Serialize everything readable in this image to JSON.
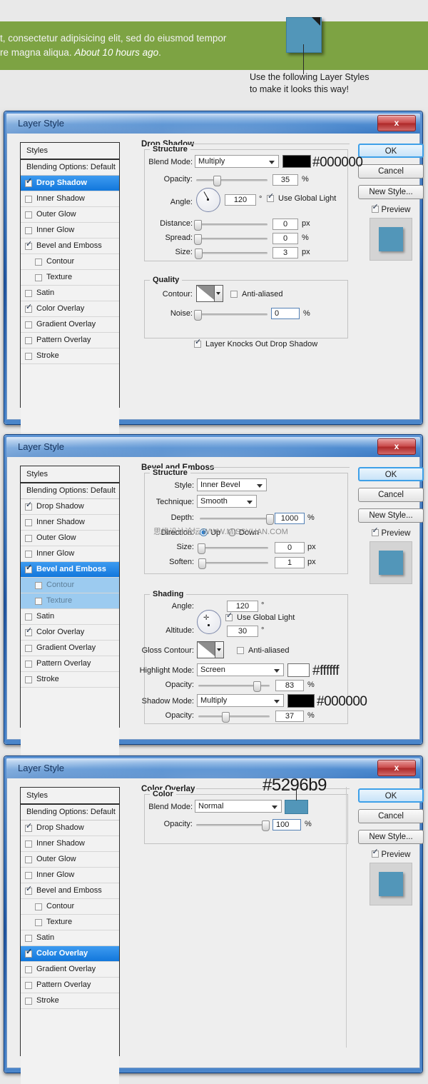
{
  "banner": {
    "text_line1": "t, consectetur adipisicing elit, sed do eiusmod tempor",
    "text_line2a": "re magna aliqua.  ",
    "text_line2b": "About 10 hours ago",
    "text_line2c": ".",
    "caption_line1": "Use the following Layer Styles",
    "caption_line2": "to make it looks this way!",
    "green_color": "#7da343",
    "square_color": "#5296b9"
  },
  "common": {
    "window_title": "Layer Style",
    "close_label": "x",
    "styles_header": "Styles",
    "blending_options": "Blending Options: Default",
    "buttons": {
      "ok": "OK",
      "cancel": "Cancel",
      "new_style": "New Style...",
      "preview": "Preview"
    },
    "style_items": [
      {
        "label": "Drop Shadow",
        "checked": true,
        "sub": false
      },
      {
        "label": "Inner Shadow",
        "checked": false,
        "sub": false
      },
      {
        "label": "Outer Glow",
        "checked": false,
        "sub": false
      },
      {
        "label": "Inner Glow",
        "checked": false,
        "sub": false
      },
      {
        "label": "Bevel and Emboss",
        "checked": true,
        "sub": false
      },
      {
        "label": "Contour",
        "checked": false,
        "sub": true
      },
      {
        "label": "Texture",
        "checked": false,
        "sub": true
      },
      {
        "label": "Satin",
        "checked": false,
        "sub": false
      },
      {
        "label": "Color Overlay",
        "checked": true,
        "sub": false
      },
      {
        "label": "Gradient Overlay",
        "checked": false,
        "sub": false
      },
      {
        "label": "Pattern Overlay",
        "checked": false,
        "sub": false
      },
      {
        "label": "Stroke",
        "checked": false,
        "sub": false
      }
    ],
    "watermark": "思缘设计论坛  WWW.MISSYUAN.COM"
  },
  "dialog1": {
    "panel_title": "Drop Shadow",
    "structure_legend": "Structure",
    "quality_legend": "Quality",
    "blend_mode_label": "Blend Mode:",
    "blend_mode_value": "Multiply",
    "blend_color_hex": "#000000",
    "opacity_label": "Opacity:",
    "opacity_value": "35",
    "opacity_unit": "%",
    "angle_label": "Angle:",
    "angle_value": "120",
    "angle_unit": "°",
    "use_global_light": "Use Global Light",
    "distance_label": "Distance:",
    "distance_value": "0",
    "distance_unit": "px",
    "spread_label": "Spread:",
    "spread_value": "0",
    "spread_unit": "%",
    "size_label": "Size:",
    "size_value": "3",
    "size_unit": "px",
    "contour_label": "Contour:",
    "anti_aliased": "Anti-aliased",
    "noise_label": "Noise:",
    "noise_value": "0",
    "noise_unit": "%",
    "knockout_label": "Layer Knocks Out Drop Shadow",
    "selected_style": "Drop Shadow"
  },
  "dialog2": {
    "panel_title": "Bevel and Emboss",
    "structure_legend": "Structure",
    "shading_legend": "Shading",
    "style_label": "Style:",
    "style_value": "Inner Bevel",
    "technique_label": "Technique:",
    "technique_value": "Smooth",
    "depth_label": "Depth:",
    "depth_value": "1000",
    "depth_unit": "%",
    "direction_label": "Direction:",
    "direction_up": "Up",
    "direction_down": "Down",
    "size_label": "Size:",
    "size_value": "0",
    "size_unit": "px",
    "soften_label": "Soften:",
    "soften_value": "1",
    "soften_unit": "px",
    "angle_label": "Angle:",
    "angle_value": "120",
    "angle_unit": "°",
    "use_global_light": "Use Global Light",
    "altitude_label": "Altitude:",
    "altitude_value": "30",
    "altitude_unit": "°",
    "gloss_contour_label": "Gloss Contour:",
    "anti_aliased": "Anti-aliased",
    "highlight_mode_label": "Highlight Mode:",
    "highlight_mode_value": "Screen",
    "highlight_hex": "#ffffff",
    "highlight_opacity_label": "Opacity:",
    "highlight_opacity_value": "83",
    "highlight_opacity_unit": "%",
    "shadow_mode_label": "Shadow Mode:",
    "shadow_mode_value": "Multiply",
    "shadow_hex": "#000000",
    "shadow_opacity_label": "Opacity:",
    "shadow_opacity_value": "37",
    "shadow_opacity_unit": "%",
    "selected_style": "Bevel and Emboss"
  },
  "dialog3": {
    "panel_title": "Color Overlay",
    "color_legend": "Color",
    "blend_mode_label": "Blend Mode:",
    "blend_mode_value": "Normal",
    "color_hex": "#5296b9",
    "opacity_label": "Opacity:",
    "opacity_value": "100",
    "opacity_unit": "%",
    "selected_style": "Color Overlay"
  }
}
